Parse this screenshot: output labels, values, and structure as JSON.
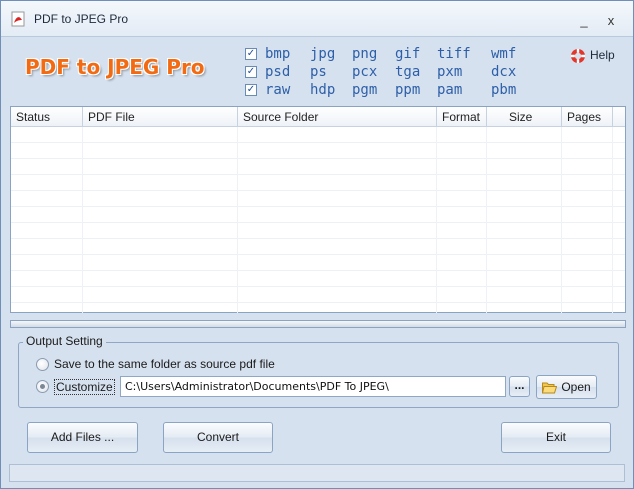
{
  "window": {
    "title": "PDF to JPEG Pro",
    "minimize_glyph": "_",
    "close_glyph": "x"
  },
  "brand": {
    "logo_text": "PDF to JPEG Pro"
  },
  "formats": {
    "rows": [
      {
        "checked": true,
        "items": [
          "bmp",
          "jpg",
          "png",
          "gif",
          "tiff",
          "wmf"
        ]
      },
      {
        "checked": true,
        "items": [
          "psd",
          "ps",
          "pcx",
          "tga",
          "pxm",
          "dcx"
        ]
      },
      {
        "checked": true,
        "items": [
          "raw",
          "hdp",
          "pgm",
          "ppm",
          "pam",
          "pbm"
        ]
      }
    ],
    "check_glyph": "✓"
  },
  "help": {
    "label": "Help",
    "icon": "lifebuoy-icon"
  },
  "file_table": {
    "columns": [
      "Status",
      "PDF File",
      "Source Folder",
      "Format",
      "Size",
      "Pages"
    ],
    "rows": []
  },
  "output_setting": {
    "legend": "Output Setting",
    "same_folder_label": "Save to the same folder as source pdf file",
    "customize_label": "Customize",
    "selected": "customize",
    "path_value": "C:\\Users\\Administrator\\Documents\\PDF To JPEG\\",
    "browse_label": "...",
    "open_label": "Open"
  },
  "actions": {
    "add_files_label": "Add Files ...",
    "convert_label": "Convert",
    "exit_label": "Exit"
  },
  "colors": {
    "brand": "#f26a12",
    "format_text": "#2d5fa8",
    "window_bg": "#d6e1ef"
  }
}
